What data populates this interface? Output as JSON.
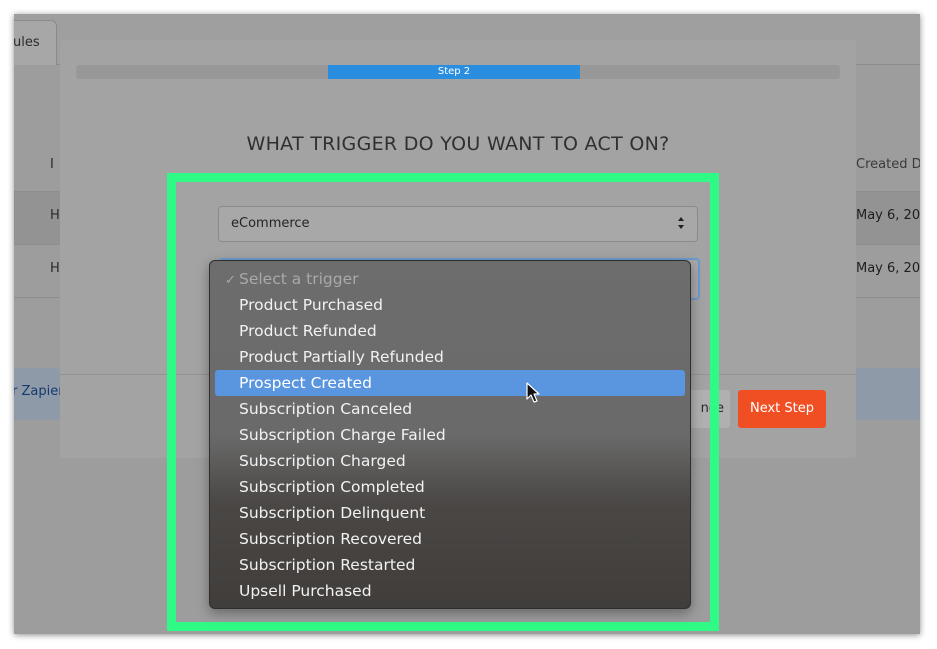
{
  "background": {
    "tab_label": "ules",
    "header_left": "I",
    "header_right": "Created Da",
    "rows": [
      {
        "left": "H",
        "right": "May 6, 202"
      },
      {
        "left": "H",
        "right": "May 6, 202"
      }
    ],
    "footer_link": "r Zapier"
  },
  "modal": {
    "step_label": "Step 2",
    "title": "WHAT TRIGGER DO YOU WANT TO ACT ON?",
    "category_select": {
      "value": "eCommerce"
    },
    "cancel_label": "nce",
    "next_label": "Next Step"
  },
  "dropdown": {
    "placeholder": "Select a trigger",
    "options": [
      "Product Purchased",
      "Product Refunded",
      "Product Partially Refunded",
      "Prospect Created",
      "Subscription Canceled",
      "Subscription Charge Failed",
      "Subscription Charged",
      "Subscription Completed",
      "Subscription Delinquent",
      "Subscription Recovered",
      "Subscription Restarted",
      "Upsell Purchased"
    ],
    "highlighted": "Prospect Created"
  },
  "colors": {
    "highlight_border": "#2ffa86",
    "selected_option": "#5a95e0",
    "next_button": "#f04e23",
    "step_progress": "#2a8ee0"
  },
  "icons": {
    "checkmark": "check-icon",
    "select_arrows": "chevron-updown-icon",
    "pointer": "mouse-pointer-icon"
  }
}
